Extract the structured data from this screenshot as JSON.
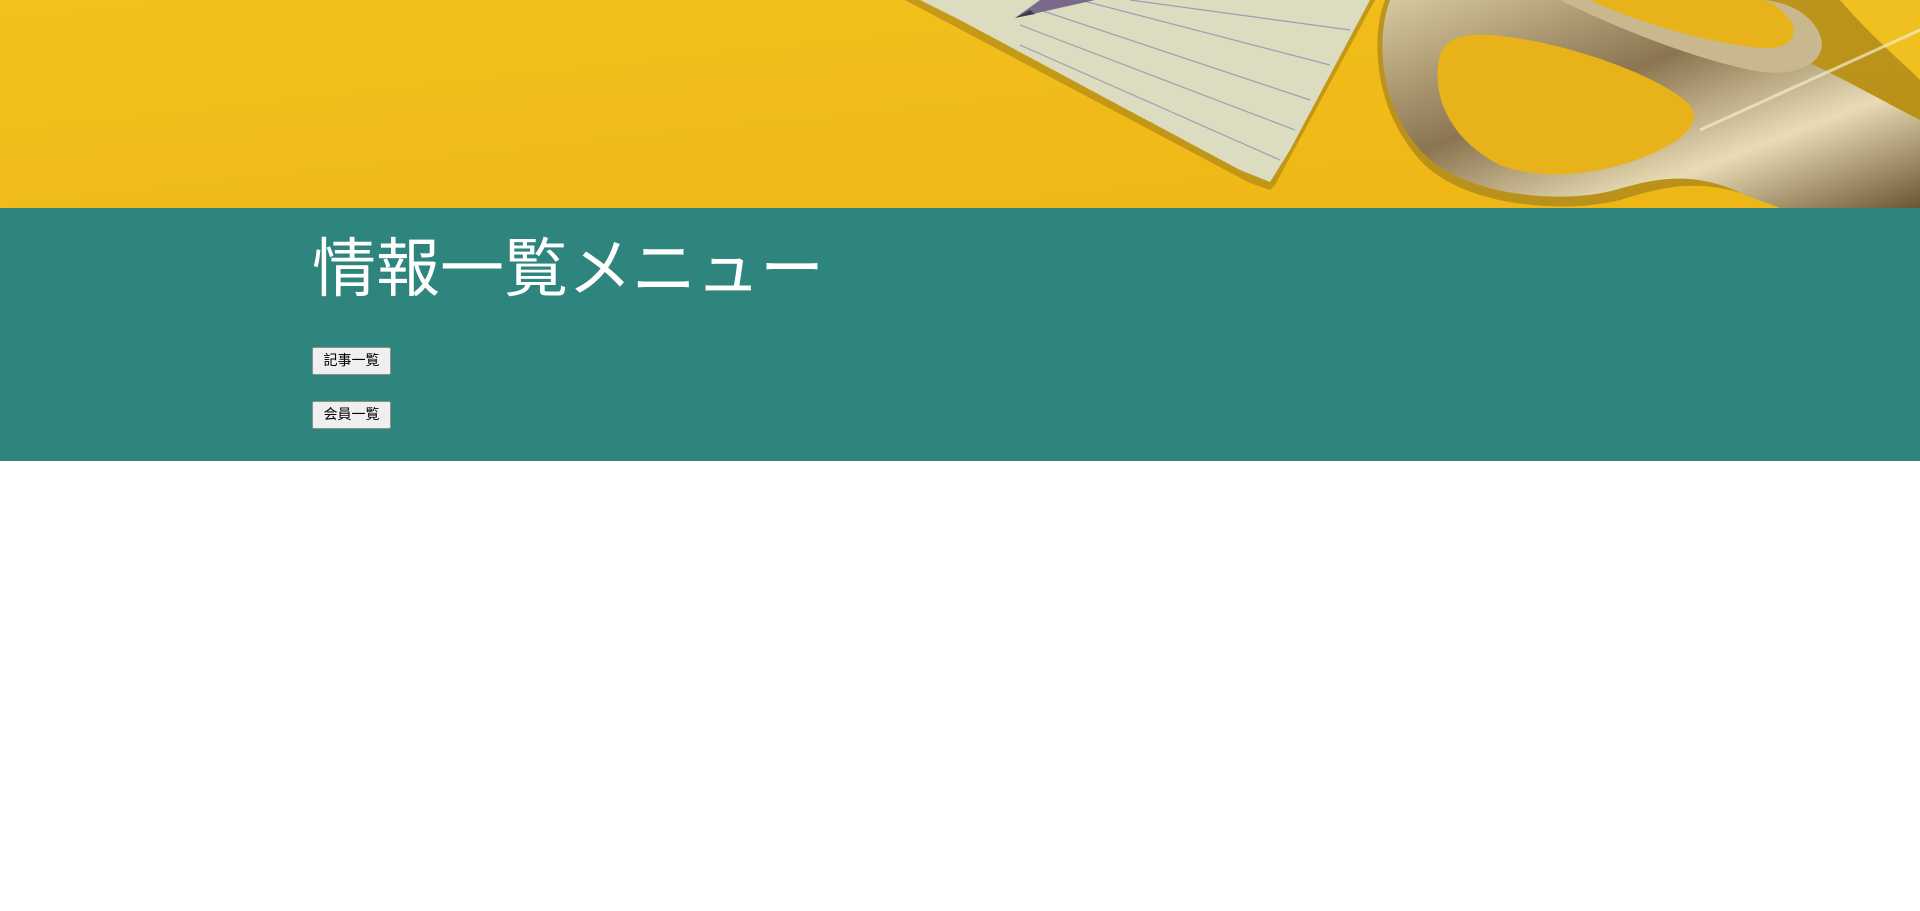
{
  "menu": {
    "title": "情報一覧メニュー",
    "buttons": [
      {
        "label": "記事一覧"
      },
      {
        "label": "会員一覧"
      }
    ]
  },
  "colors": {
    "hero_background": "#f4c01f",
    "panel_background": "#2e857d",
    "title_text": "#ffffff",
    "page_background": "#ffffff"
  },
  "hero": {
    "depicts": [
      "yellow-desk-surface",
      "lined-notepad",
      "pencil-tip",
      "gold-scissors"
    ]
  }
}
